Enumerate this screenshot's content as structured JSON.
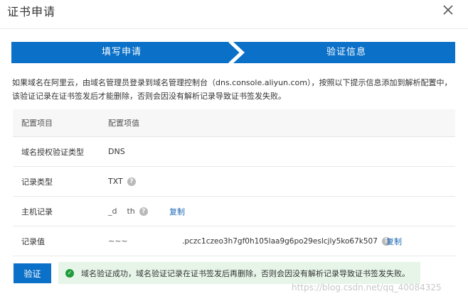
{
  "dialog": {
    "title": "证书申请",
    "close_label": "×"
  },
  "steps": {
    "step1": "填写申请",
    "step2": "验证信息",
    "color": "#0a70c8"
  },
  "description": "如果域名在阿里云，由域名管理员登录到域名管理控制台（dns.console.aliyun.com），按照以下提示信息添加到解析配置中，该验证记录在证书签发后才能删除，否则会因没有解析记录导致证书签发失败。",
  "table": {
    "headers": [
      "配置项目",
      "配置项值"
    ],
    "rows": [
      {
        "label": "域名授权验证类型",
        "value": "DNS"
      },
      {
        "label": "记录类型",
        "value": "TXT",
        "help_icon": "question-icon"
      },
      {
        "label": "主机记录",
        "value": "_d    th",
        "help_icon": "question-icon",
        "copy": "复制"
      },
      {
        "label": "记录值",
        "value_prefix": "~~~",
        "value": ".pczc1czeo3h7gf0h105laa9g6po29eslcjly5ko67k507",
        "help_icon": "question-icon",
        "copy": "复制"
      }
    ]
  },
  "footer": {
    "verify_button": "验证",
    "success_message": "域名验证成功，域名验证记录在证书签发后再删除，否则会因没有解析记录导致证书签发失败。",
    "success_color": "#1e9b3c"
  },
  "watermark": "https://blog.csdn.net/qq_40084325"
}
